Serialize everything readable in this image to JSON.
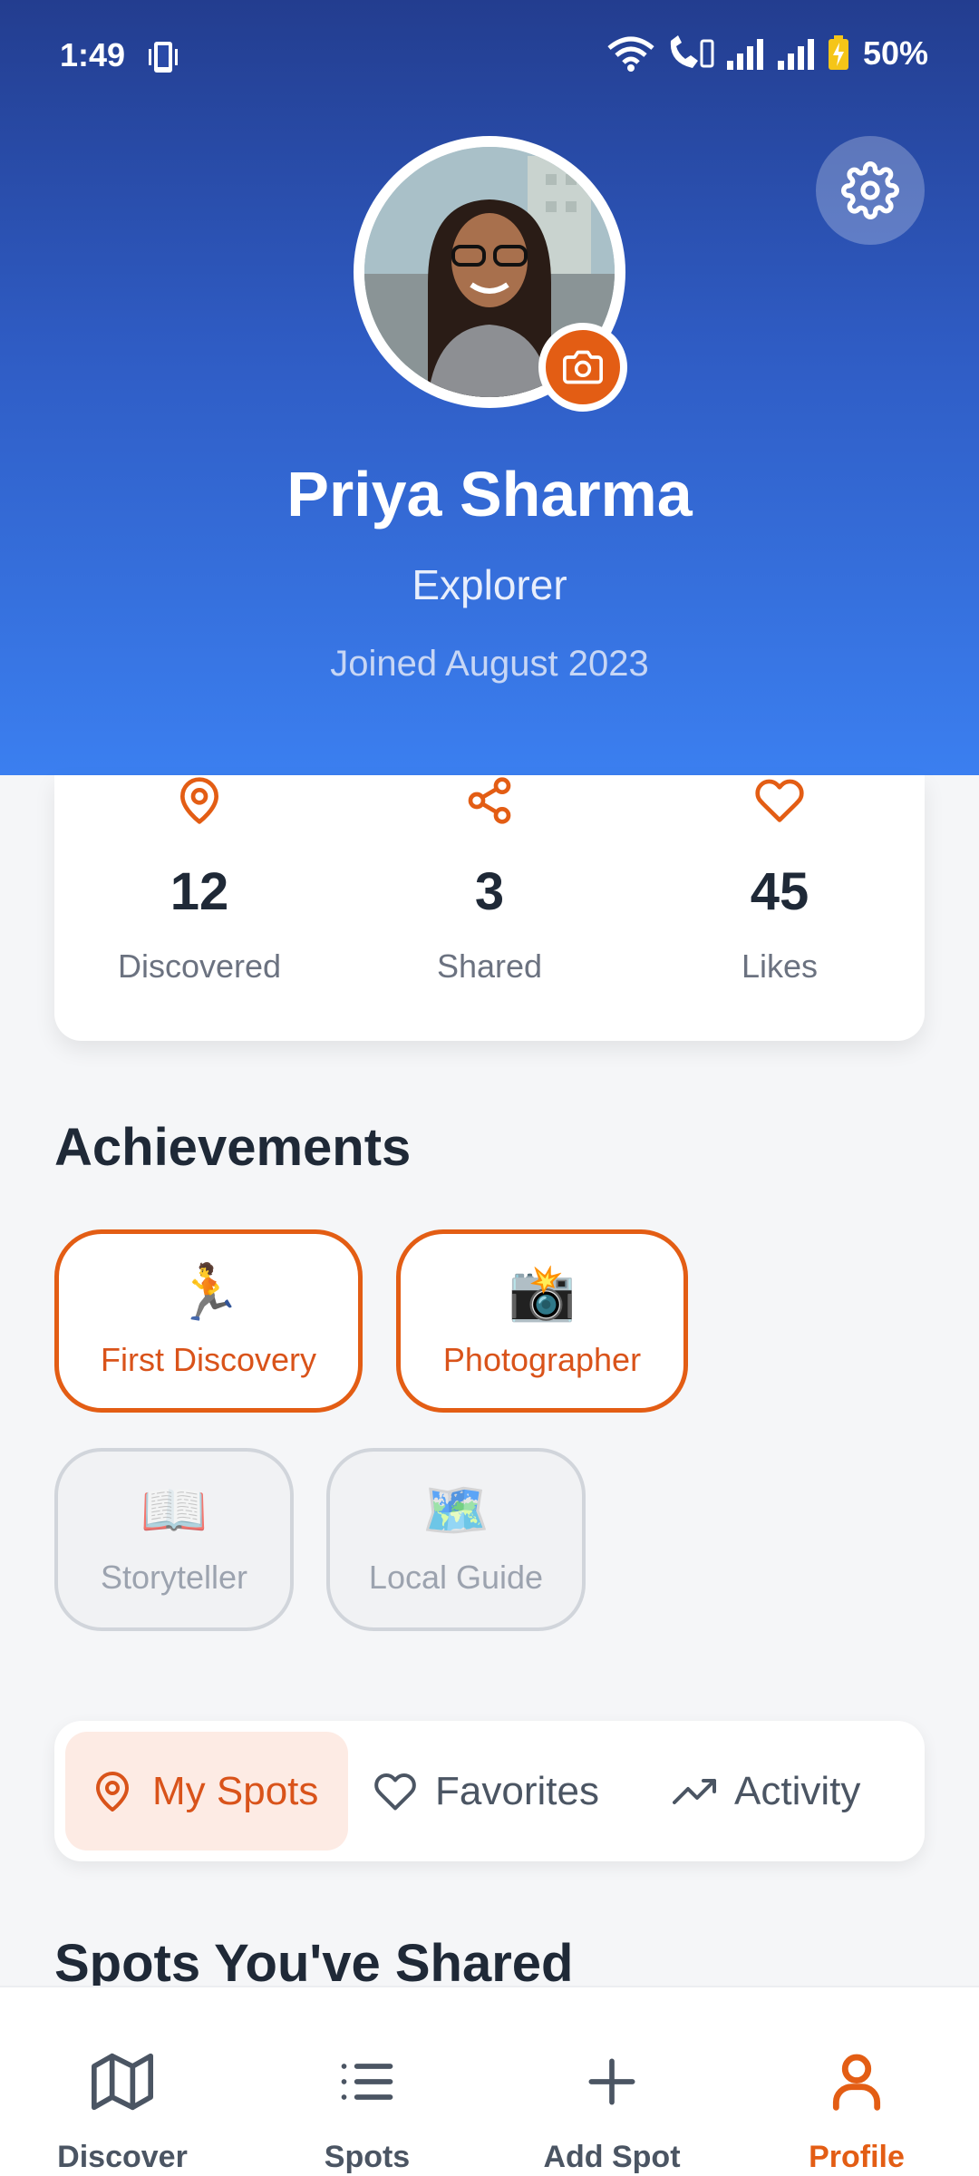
{
  "status_bar": {
    "time": "1:49",
    "battery_pct": "50%"
  },
  "profile": {
    "name": "Priya Sharma",
    "role": "Explorer",
    "joined": "Joined August 2023"
  },
  "stats": [
    {
      "value": "12",
      "label": "Discovered",
      "icon": "map-pin-icon"
    },
    {
      "value": "3",
      "label": "Shared",
      "icon": "share-icon"
    },
    {
      "value": "45",
      "label": "Likes",
      "icon": "heart-icon"
    }
  ],
  "achievements": {
    "title": "Achievements",
    "items": [
      {
        "emoji": "🏃",
        "label": "First Discovery",
        "earned": true
      },
      {
        "emoji": "📸",
        "label": "Photographer",
        "earned": true
      },
      {
        "emoji": "📖",
        "label": "Storyteller",
        "earned": false
      },
      {
        "emoji": "🗺️",
        "label": "Local Guide",
        "earned": false
      }
    ]
  },
  "tabs": {
    "items": [
      {
        "label": "My Spots",
        "active": true
      },
      {
        "label": "Favorites",
        "active": false
      },
      {
        "label": "Activity",
        "active": false
      }
    ]
  },
  "shared_section": {
    "title": "Spots You've Shared"
  },
  "nav": {
    "items": [
      {
        "label": "Discover",
        "icon": "map-icon",
        "active": false
      },
      {
        "label": "Spots",
        "icon": "list-icon",
        "active": false
      },
      {
        "label": "Add Spot",
        "icon": "plus-icon",
        "active": false
      },
      {
        "label": "Profile",
        "icon": "user-icon",
        "active": true
      }
    ]
  },
  "colors": {
    "accent": "#e35d14",
    "header_top": "#233d8f",
    "header_bottom": "#3b7ff0"
  }
}
